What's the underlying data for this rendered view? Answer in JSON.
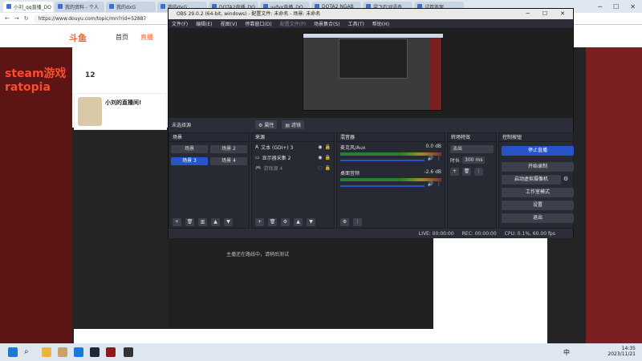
{
  "browser": {
    "tabs": [
      {
        "label": "小刘_qq直播_DO"
      },
      {
        "label": "我的资料 - 个人"
      },
      {
        "label": "我的dxG"
      },
      {
        "label": "我的dxG"
      },
      {
        "label": "DOTA2直播_DO"
      },
      {
        "label": "yyfyx直播_DO"
      },
      {
        "label": "DOTA2 NGAB"
      },
      {
        "label": "梁飞石词语查"
      },
      {
        "label": "试卷答案"
      }
    ],
    "url": "https://www.douyu.com/topic/mn?rid=528878"
  },
  "site": {
    "logo": "斗鱼",
    "nav_home": "首页",
    "nav_live": "直播",
    "left_banner_line1": "steam游戏",
    "left_banner_line2": "ratopia",
    "stat_num": "12",
    "streamer_title": "小刘的直播间!",
    "player_hint": "主播还在路线中，请稍后测试"
  },
  "obs": {
    "title": "OBS 29.0.2 (64-bit, windows) - 配置文件: 未命名 - 场景: 未命名",
    "menu": [
      "文件(F)",
      "编辑(E)",
      "视图(V)",
      "停靠窗口(D)",
      "配置文件(P)",
      "场景集合(S)",
      "工具(T)",
      "帮助(H)"
    ],
    "no_source": "未选择源",
    "properties": "属性",
    "filters": "滤镜",
    "docks": {
      "scenes": "场景",
      "sources": "来源",
      "mixer": "混音器",
      "transitions": "转场特效",
      "controls": "控制按钮"
    },
    "scenes": [
      "场景",
      "场景 2",
      "场景 3",
      "场景 4"
    ],
    "sources": [
      "文本 (GDI+) 3",
      "显示器采集 2",
      "游戏源 4"
    ],
    "mixer": [
      {
        "name": "麦克风/Aux",
        "db": "0.0 dB"
      },
      {
        "name": "桌面音频",
        "db": "-2.6 dB"
      }
    ],
    "transition": {
      "type": "淡出",
      "duration_label": "时长",
      "duration": "300 ms"
    },
    "controls": [
      "停止直播",
      "开始录制",
      "启动虚拟摄像机",
      "工作室模式",
      "设置",
      "退出"
    ],
    "status": {
      "live": "LIVE: 00:00:00",
      "rec": "REC: 00:00:00",
      "cpu": "CPU: 0.1%, 60.00 fps"
    }
  },
  "taskbar": {
    "ime": "中",
    "time": "14:35",
    "date": "2023/11/21"
  }
}
